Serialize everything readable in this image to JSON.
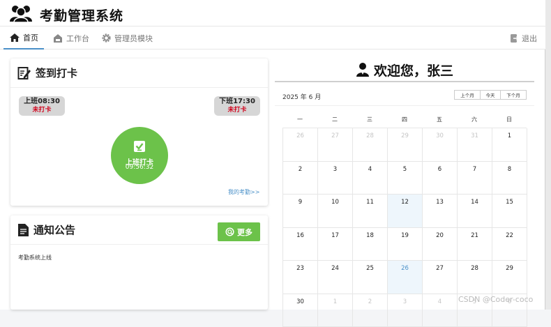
{
  "app": {
    "title": "考勤管理系统",
    "logo_icon": "users-group-icon"
  },
  "nav": {
    "items": [
      {
        "label": "首页",
        "icon": "home-icon",
        "active": true
      },
      {
        "label": "工作台",
        "icon": "briefcase-icon",
        "active": false
      },
      {
        "label": "管理员模块",
        "icon": "gear-icon",
        "active": false
      }
    ],
    "logout_label": "退出"
  },
  "checkin": {
    "title": "签到打卡",
    "on_duty": {
      "time": "上班08:30",
      "status": "未打卡"
    },
    "off_duty": {
      "time": "下班17:30",
      "status": "未打卡"
    },
    "punch": {
      "label": "上班打卡",
      "clock": "09:56:32"
    },
    "my_attendance_link": "我的考勤>>"
  },
  "notice": {
    "title": "通知公告",
    "more_label": "更多",
    "items": [
      "考勤系统上线"
    ]
  },
  "welcome": {
    "text": "欢迎您，张三"
  },
  "calendar": {
    "month_label": "2025 年 6 月",
    "buttons": {
      "prev": "上个月",
      "today": "今天",
      "next": "下个月"
    },
    "weekdays": [
      "一",
      "二",
      "三",
      "四",
      "五",
      "六",
      "日"
    ],
    "days": [
      {
        "d": "26",
        "other": true
      },
      {
        "d": "27",
        "other": true
      },
      {
        "d": "28",
        "other": true
      },
      {
        "d": "29",
        "other": true
      },
      {
        "d": "30",
        "other": true
      },
      {
        "d": "31",
        "other": true
      },
      {
        "d": "1"
      },
      {
        "d": "2"
      },
      {
        "d": "3"
      },
      {
        "d": "4"
      },
      {
        "d": "5"
      },
      {
        "d": "6"
      },
      {
        "d": "7"
      },
      {
        "d": "8"
      },
      {
        "d": "9"
      },
      {
        "d": "10"
      },
      {
        "d": "11"
      },
      {
        "d": "12",
        "hl": true
      },
      {
        "d": "13"
      },
      {
        "d": "14"
      },
      {
        "d": "15"
      },
      {
        "d": "16"
      },
      {
        "d": "17"
      },
      {
        "d": "18"
      },
      {
        "d": "19"
      },
      {
        "d": "20"
      },
      {
        "d": "21"
      },
      {
        "d": "22"
      },
      {
        "d": "23"
      },
      {
        "d": "24"
      },
      {
        "d": "25"
      },
      {
        "d": "26",
        "hl": true,
        "today": true
      },
      {
        "d": "27"
      },
      {
        "d": "28"
      },
      {
        "d": "29"
      },
      {
        "d": "30"
      },
      {
        "d": "1",
        "other": true
      },
      {
        "d": "2",
        "other": true
      },
      {
        "d": "3",
        "other": true
      },
      {
        "d": "4",
        "other": true
      },
      {
        "d": "5",
        "other": true
      },
      {
        "d": "6",
        "other": true
      }
    ]
  },
  "watermark": "CSDN @Coder-coco",
  "colors": {
    "accent_green": "#6cc24a",
    "link_blue": "#4a90c8",
    "alert_red": "#d0021b"
  }
}
